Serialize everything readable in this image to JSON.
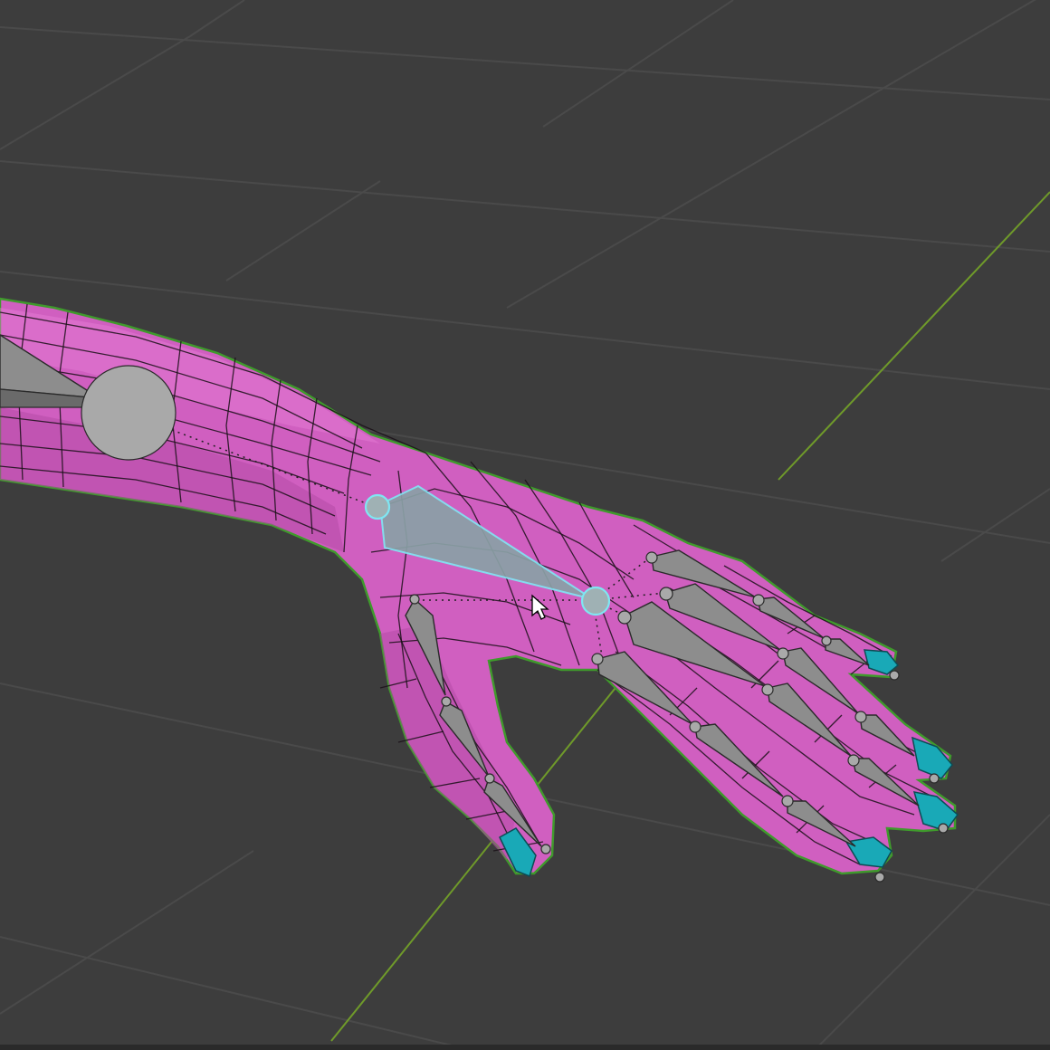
{
  "viewport": {
    "mode": "3d-viewport",
    "background_color": "#3d3d3d",
    "grid_color": "#4a4a4a",
    "axis_color": "#6f9a2a",
    "mesh_color": "#d05fc0",
    "mesh_outline_color": "#3f9a2c",
    "bone_color": "#8d8d8d",
    "selected_bone_outline": "#7fe6f2",
    "nail_color": "#19a9b7",
    "cursor_icon": "mouse-pointer-icon"
  }
}
